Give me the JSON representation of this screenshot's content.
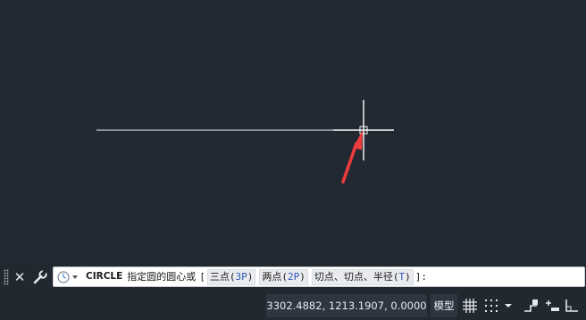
{
  "command_line": {
    "command": "CIRCLE",
    "prompt": "指定圆的圆心或",
    "open_bracket": "[",
    "options": [
      {
        "label": "三点",
        "key": "3P"
      },
      {
        "label": "两点",
        "key": "2P"
      },
      {
        "label": "切点、切点、半径",
        "key": "T"
      }
    ],
    "close_bracket": "]:",
    "close_icon": "close-icon",
    "settings_icon": "wrench-icon",
    "recent_icon": "recent-commands-icon"
  },
  "status_bar": {
    "coordinates": "3302.4882, 1213.1907, 0.0000",
    "model_label": "模型",
    "icons": [
      "grid-icon",
      "snap-icon",
      "dropdown-icon",
      "infer-constraints-icon",
      "dynamic-input-icon",
      "ortho-icon"
    ]
  },
  "colors": {
    "canvas_bg": "#222933",
    "crosshair": "#ffffff",
    "arrow": "#ef3b3b"
  }
}
